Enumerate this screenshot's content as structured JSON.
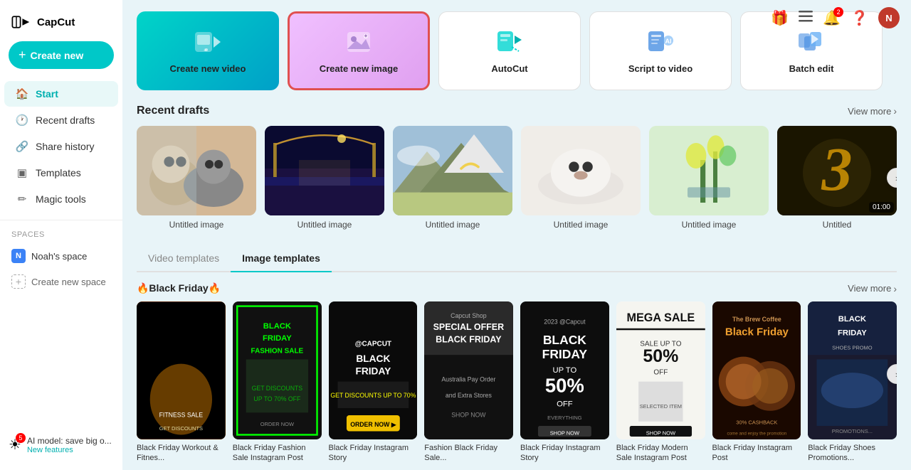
{
  "app": {
    "name": "CapCut",
    "logo_unicode": "✂"
  },
  "sidebar": {
    "create_button_label": "Create new",
    "nav_items": [
      {
        "id": "start",
        "label": "Start",
        "icon": "🏠",
        "active": true
      },
      {
        "id": "recent",
        "label": "Recent drafts",
        "icon": "🕐"
      },
      {
        "id": "history",
        "label": "Share history",
        "icon": "🔗"
      },
      {
        "id": "templates",
        "label": "Templates",
        "icon": "▣"
      },
      {
        "id": "magic",
        "label": "Magic tools",
        "icon": "✏"
      }
    ],
    "spaces_label": "Spaces",
    "space_name": "Noah's space",
    "space_initial": "N",
    "create_space_label": "Create new space",
    "ai_notice": {
      "title": "AI model: save big o...",
      "subtitle": "New features",
      "badge_count": "5"
    }
  },
  "topbar": {
    "gift_icon": "🎁",
    "menu_icon": "☰",
    "notification_icon": "🔔",
    "notification_count": "2",
    "help_icon": "❓"
  },
  "action_cards": [
    {
      "id": "create-video",
      "label": "Create new video",
      "type": "video"
    },
    {
      "id": "create-image",
      "label": "Create new image",
      "type": "image"
    },
    {
      "id": "autocut",
      "label": "AutoCut",
      "type": "autocut"
    },
    {
      "id": "script-to-video",
      "label": "Script to video",
      "type": "script"
    },
    {
      "id": "batch-edit",
      "label": "Batch edit",
      "type": "batch"
    }
  ],
  "recent_drafts": {
    "section_title": "Recent drafts",
    "view_more": "View more",
    "items": [
      {
        "id": 1,
        "label": "Untitled image",
        "type": "image",
        "bg": "img-cats"
      },
      {
        "id": 2,
        "label": "Untitled image",
        "type": "image",
        "bg": "img-night"
      },
      {
        "id": 3,
        "label": "Untitled image",
        "type": "image",
        "bg": "img-mountain"
      },
      {
        "id": 4,
        "label": "Untitled image",
        "type": "image",
        "bg": "img-dog-white"
      },
      {
        "id": 5,
        "label": "Untitled image",
        "type": "image",
        "bg": "img-flowers"
      },
      {
        "id": 6,
        "label": "Untitled",
        "type": "video",
        "bg": "img-number3",
        "duration": "01:00"
      }
    ]
  },
  "templates": {
    "tabs": [
      {
        "id": "video",
        "label": "Video templates",
        "active": false
      },
      {
        "id": "image",
        "label": "Image templates",
        "active": true
      }
    ],
    "section_title": "🔥Black Friday🔥",
    "view_more": "View more",
    "items": [
      {
        "id": 1,
        "label": "Black Friday Workout & Fitnes...",
        "bg": "tmpl-orange"
      },
      {
        "id": 2,
        "label": "Black Friday Fashion Sale Instagram Post",
        "bg": "tmpl-green"
      },
      {
        "id": 3,
        "label": "Black Friday Instagram Story",
        "bg": "tmpl-dark"
      },
      {
        "id": 4,
        "label": "Fashion Black Friday Sale...",
        "bg": "tmpl-gray"
      },
      {
        "id": 5,
        "label": "Black Friday Instagram Story",
        "bg": "tmpl-dark2"
      },
      {
        "id": 6,
        "label": "Black Friday Modern Sale Instagram Post",
        "bg": "tmpl-white"
      },
      {
        "id": 7,
        "label": "Black Friday Instagram Post",
        "bg": "tmpl-white"
      },
      {
        "id": 8,
        "label": "Black Friday Shoes Promotions...",
        "bg": "tmpl-coffee"
      }
    ]
  }
}
